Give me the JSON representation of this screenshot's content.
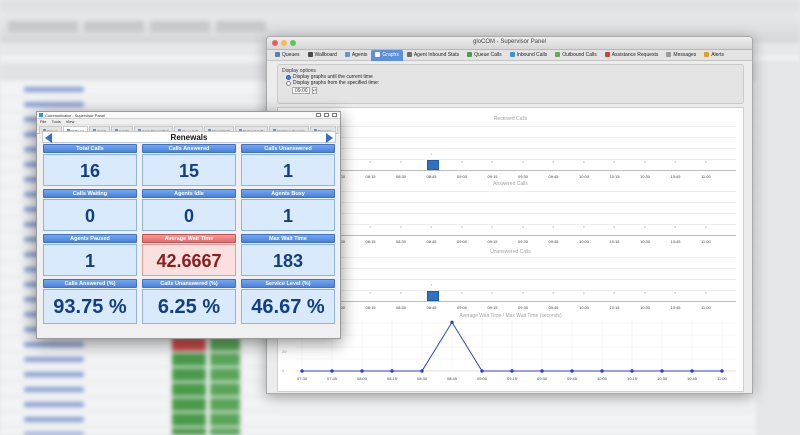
{
  "supervisor": {
    "title": "gloCOM - Supervisor Panel",
    "tabs": [
      {
        "label": "Queues",
        "icon": "queues-icon",
        "color": "#5a7db8"
      },
      {
        "label": "Wallboard",
        "icon": "wallboard-icon",
        "color": "#4a4a4a"
      },
      {
        "label": "Agents",
        "icon": "agents-icon",
        "color": "#6b8fc7"
      },
      {
        "label": "Graphs",
        "icon": "graphs-icon",
        "color": "#ffffff",
        "active": true
      },
      {
        "label": "Agent Inbound Stats",
        "icon": "agent-stats-icon",
        "color": "#6c6c6c"
      },
      {
        "label": "Queue Calls",
        "icon": "queue-calls-icon",
        "color": "#4aa04a"
      },
      {
        "label": "Inbound Calls",
        "icon": "inbound-calls-icon",
        "color": "#3f8fd0"
      },
      {
        "label": "Outbound Calls",
        "icon": "outbound-calls-icon",
        "color": "#5bb04b"
      },
      {
        "label": "Assistance Requests",
        "icon": "assistance-icon",
        "color": "#d04040"
      },
      {
        "label": "Messages",
        "icon": "messages-icon",
        "color": "#9a9a9a"
      },
      {
        "label": "Alerts",
        "icon": "alerts-icon",
        "color": "#e0a020"
      }
    ],
    "options": {
      "legend": "Display options",
      "radio_current": "Display graphs until the current time",
      "radio_specified": "Display graphs from the specified time:",
      "time_value": "09:00"
    },
    "graphs": {
      "received_title": "Received Calls",
      "answered_title": "Answered Calls",
      "unanswered_title": "Unanswered Calls",
      "wait_title": "Average Wait Time / Max Wait Time (seconds)",
      "time_ticks": [
        "08:00",
        "08:15",
        "08:30",
        "08:45",
        "09:00",
        "09:15",
        "09:30",
        "09:45",
        "10:00",
        "10:15",
        "10:30",
        "10:45",
        "11:00"
      ],
      "wait_ticks": [
        "07:30",
        "07:45",
        "08:00",
        "08:15",
        "08:30",
        "08:45",
        "09:00",
        "09:15",
        "09:30",
        "09:45",
        "10:00",
        "10:15",
        "10:30",
        "10:45",
        "11:00"
      ],
      "zero_label": "0",
      "wait_y_labels": [
        "40",
        "20",
        "0"
      ]
    }
  },
  "communicator": {
    "title": "Communicator - Supervisor Panel",
    "menu": [
      "File",
      "Tools",
      "View"
    ],
    "tabs": [
      "Queues",
      "Wallboard",
      "Agents",
      "Graphs",
      "Agent Inbound Stats",
      "Queue Calls",
      "Inbound Calls",
      "Outbound Calls",
      "Assistance Requests",
      "Messages",
      "Alerts"
    ],
    "queue_name": "Renewals",
    "stats": [
      {
        "label": "Total Calls",
        "value": "16"
      },
      {
        "label": "Calls Answered",
        "value": "15"
      },
      {
        "label": "Calls Unanswered",
        "value": "1"
      },
      {
        "label": "Calls Waiting",
        "value": "0"
      },
      {
        "label": "Agents Idle",
        "value": "0"
      },
      {
        "label": "Agents Busy",
        "value": "1"
      },
      {
        "label": "Agents Paused",
        "value": "1"
      },
      {
        "label": "Average Wait Time",
        "value": "42.6667",
        "alert": true
      },
      {
        "label": "Max Wait Time",
        "value": "183"
      },
      {
        "label": "Calls Answered (%)",
        "value": "93.75 %"
      },
      {
        "label": "Calls Unanswered (%)",
        "value": "6.25 %"
      },
      {
        "label": "Service Level (%)",
        "value": "46.67 %"
      }
    ]
  },
  "chart_data": [
    {
      "type": "bar",
      "title": "Received Calls",
      "categories": [
        "08:00",
        "08:15",
        "08:30",
        "08:45",
        "09:00",
        "09:15",
        "09:30",
        "09:45",
        "10:00",
        "10:15",
        "10:30",
        "10:45",
        "11:00"
      ],
      "values": [
        0,
        0,
        0,
        1,
        0,
        0,
        0,
        0,
        0,
        0,
        0,
        0,
        0
      ]
    },
    {
      "type": "bar",
      "title": "Answered Calls",
      "categories": [
        "08:00",
        "08:15",
        "08:30",
        "08:45",
        "09:00",
        "09:15",
        "09:30",
        "09:45",
        "10:00",
        "10:15",
        "10:30",
        "10:45",
        "11:00"
      ],
      "values": [
        0,
        0,
        0,
        0,
        0,
        0,
        0,
        0,
        0,
        0,
        0,
        0,
        0
      ]
    },
    {
      "type": "bar",
      "title": "Unanswered Calls",
      "categories": [
        "08:00",
        "08:15",
        "08:30",
        "08:45",
        "09:00",
        "09:15",
        "09:30",
        "09:45",
        "10:00",
        "10:15",
        "10:30",
        "10:45",
        "11:00"
      ],
      "values": [
        0,
        0,
        0,
        1,
        0,
        0,
        0,
        0,
        0,
        0,
        0,
        0,
        0
      ]
    },
    {
      "type": "line",
      "title": "Average Wait Time / Max Wait Time (seconds)",
      "x": [
        "07:30",
        "07:45",
        "08:00",
        "08:15",
        "08:30",
        "08:45",
        "09:00",
        "09:15",
        "09:30",
        "09:45",
        "10:00",
        "10:15",
        "10:30",
        "10:45",
        "11:00"
      ],
      "values": [
        0,
        0,
        0,
        0,
        0,
        43,
        0,
        0,
        0,
        0,
        0,
        0,
        0,
        0,
        0
      ],
      "ylim": [
        0,
        45
      ]
    }
  ]
}
